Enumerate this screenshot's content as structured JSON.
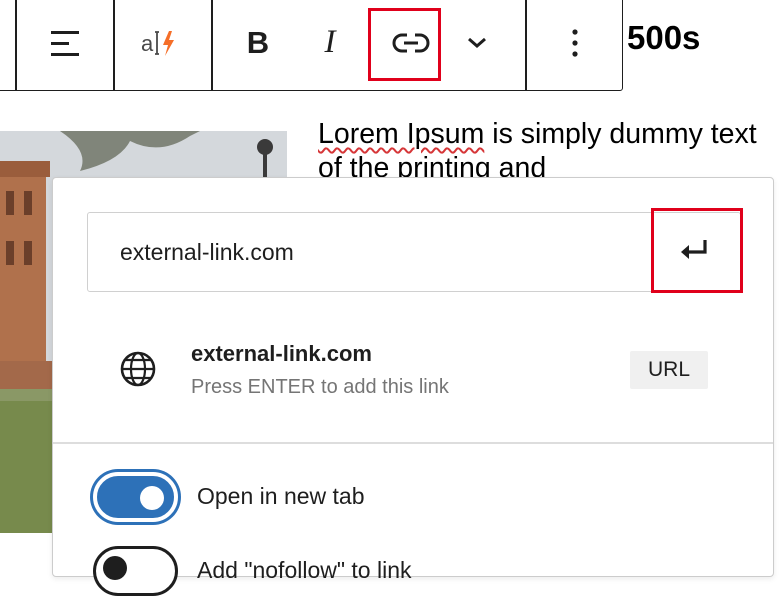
{
  "toolbar": {
    "heading_fragment": "500s",
    "bold_glyph": "B",
    "italic_glyph": "I",
    "icons": [
      "align-icon",
      "text-transform-icon",
      "bold-icon",
      "italic-icon",
      "link-icon",
      "chevron-down-icon",
      "more-options-icon"
    ]
  },
  "content": {
    "paragraph_spellcheck": "Lorem Ipsum",
    "paragraph_rest": " is simply dummy text of the printing and"
  },
  "link_popover": {
    "url_value": "external-link.com",
    "submit_icon": "enter-icon",
    "suggestion": {
      "title": "external-link.com",
      "hint": "Press ENTER to add this link",
      "type_badge": "URL",
      "icon": "globe-icon"
    },
    "settings": [
      {
        "label": "Open in new tab",
        "checked": true
      },
      {
        "label": "Add \"nofollow\" to link",
        "checked": false
      }
    ]
  },
  "colors": {
    "highlight": "#e0001b",
    "toggle_on": "#2d71b8",
    "lightning_accent": "#f56e28"
  }
}
